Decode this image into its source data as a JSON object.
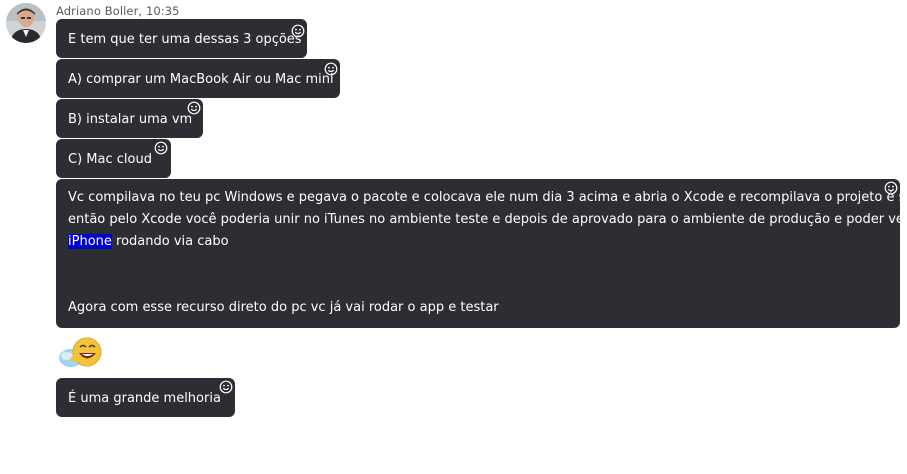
{
  "sender": {
    "name_time": "Adriano Boller, 10:35"
  },
  "messages": [
    {
      "text": "E tem que ter uma dessas 3 opções"
    },
    {
      "text": "A) comprar um MacBook Air ou Mac mini"
    },
    {
      "text": "B) instalar uma vm"
    },
    {
      "text": "C) Mac cloud"
    },
    {
      "line1": "Vc compilava no teu pc Windows e pegava o pacote e colocava ele num dia 3 acima e abria o Xcode e recompilava o projeto é só",
      "line2": "então pelo Xcode você poderia unir no iTunes no ambiente teste e depois de aprovado para o ambiente de produção e poder ver no",
      "line3_highlight": "iPhone",
      "line3_rest": " rodando via cabo",
      "line4": "Agora com esse recurso direto do pc vc já vai rodar o app e testar"
    },
    {
      "text": "É uma grande melhoria"
    }
  ],
  "icons": {
    "reaction": "smiley-icon",
    "sticker": "laughing-emoji-sticker"
  }
}
